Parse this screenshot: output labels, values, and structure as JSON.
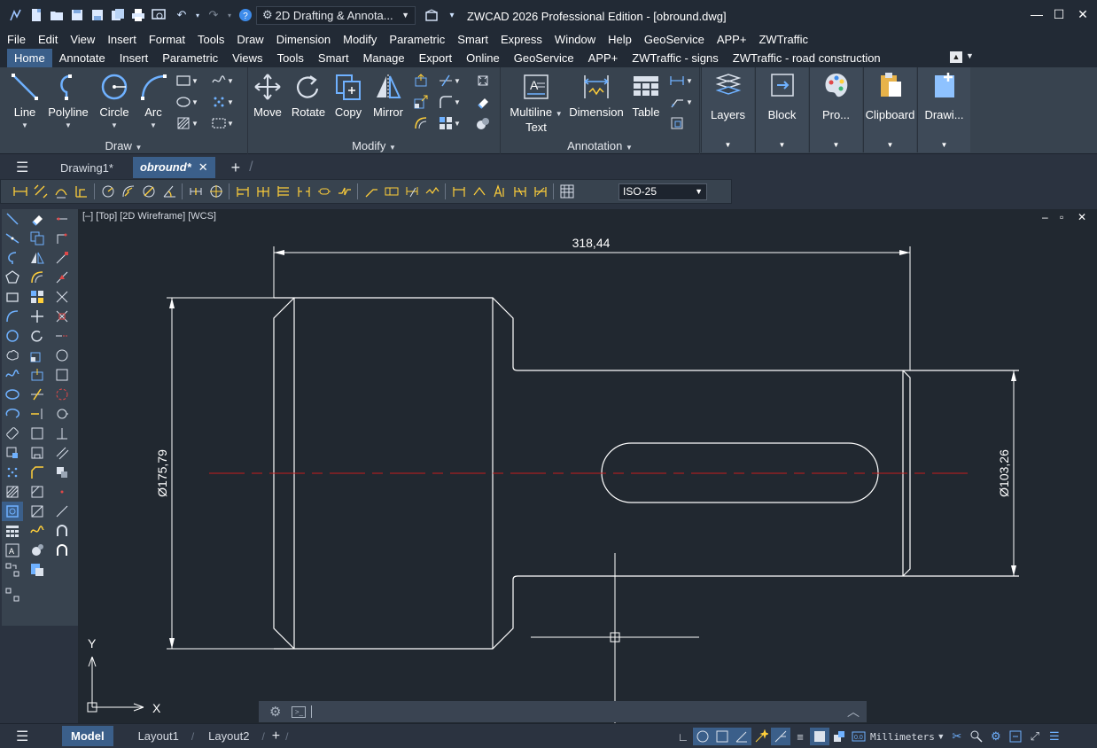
{
  "window": {
    "title": "ZWCAD 2026 Professional Edition - [obround.dwg]",
    "workspace": "2D Drafting & Annota...",
    "controls": [
      "—",
      "☐",
      "✕"
    ]
  },
  "menu": [
    "File",
    "Edit",
    "View",
    "Insert",
    "Format",
    "Tools",
    "Draw",
    "Dimension",
    "Modify",
    "Parametric",
    "Smart",
    "Express",
    "Window",
    "Help",
    "GeoService",
    "APP+",
    "ZWTraffic"
  ],
  "ribbon_tabs": [
    "Home",
    "Annotate",
    "Insert",
    "Parametric",
    "Views",
    "Tools",
    "Smart",
    "Manage",
    "Export",
    "Online",
    "GeoService",
    "APP+",
    "ZWTraffic - signs",
    "ZWTraffic - road construction"
  ],
  "ribbon": {
    "draw": {
      "label": "Draw",
      "line": "Line",
      "polyline": "Polyline",
      "circle": "Circle",
      "arc": "Arc"
    },
    "modify": {
      "label": "Modify",
      "move": "Move",
      "rotate": "Rotate",
      "copy": "Copy",
      "mirror": "Mirror"
    },
    "annotation": {
      "label": "Annotation",
      "mtext_1": "Multiline",
      "mtext_2": "Text",
      "dimension": "Dimension",
      "table": "Table"
    },
    "panels": {
      "layers": "Layers",
      "block": "Block",
      "properties": "Pro...",
      "clipboard": "Clipboard",
      "drawing": "Drawi..."
    }
  },
  "doc_tabs": {
    "tab1": "Drawing1*",
    "tab2": "obround*",
    "close": "✕",
    "add": "+"
  },
  "dim_toolbar": {
    "dim_style": "ISO-25"
  },
  "viewport": {
    "label": "[–] [Top] [2D Wireframe] [WCS]",
    "controls": [
      "–",
      "▫",
      "✕"
    ],
    "dimensions": {
      "horizontal": "318,44",
      "left_diameter": "Ø175,79",
      "right_diameter": "Ø103,26"
    },
    "ucs": {
      "x": "X",
      "y": "Y"
    }
  },
  "command_line": {
    "text": ""
  },
  "status": {
    "layouts": [
      "Model",
      "Layout1",
      "Layout2"
    ],
    "add": "+",
    "units": "Millimeters"
  },
  "colors": {
    "accent": "#3b5f8a",
    "centerline": "#c81d1d",
    "geometry": "#ffffff",
    "canvas": "#212830"
  }
}
